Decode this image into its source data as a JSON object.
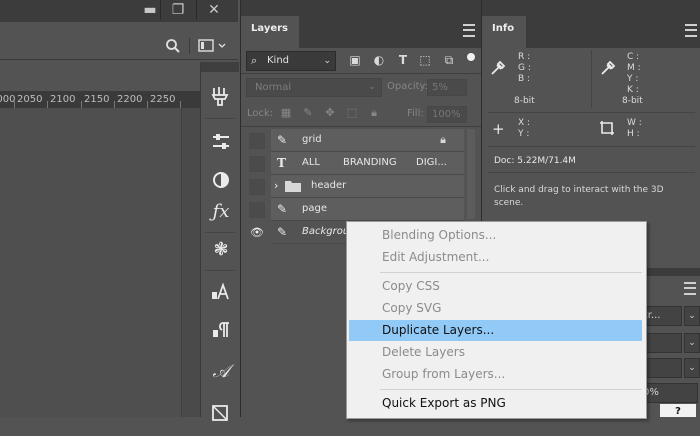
{
  "window": {
    "minimize_glyph": "▬",
    "restore_glyph": "❐",
    "close_glyph": "✕"
  },
  "options_bar": {
    "search_icon": "search-icon",
    "workspace_icon": "workspace-icon"
  },
  "ruler": {
    "ticks": [
      "2000",
      "2050",
      "2100",
      "2150",
      "2200",
      "2250"
    ]
  },
  "tools": [
    "brush-settings-icon",
    "adjust-icon",
    "color-icon",
    "styles-icon",
    "gear-wheel-icon",
    "character-icon",
    "paragraph-icon",
    "glyphs-icon",
    "swatch-icon"
  ],
  "layers_panel": {
    "tab_label": "Layers",
    "filter_kind": "Kind",
    "blend_mode": "Normal",
    "opacity_label": "Opacity:",
    "opacity_value": "5%",
    "lock_label": "Lock:",
    "fill_label": "Fill:",
    "fill_value": "100%",
    "layers": [
      {
        "name": "grid",
        "type": "brush",
        "visible": false,
        "locked": true
      },
      {
        "name": "ALL BRANDING DIGI...",
        "type": "text",
        "visible": false,
        "locked": false
      },
      {
        "name": "header",
        "type": "folder",
        "visible": false,
        "locked": false
      },
      {
        "name": "page",
        "type": "brush",
        "visible": false,
        "locked": false
      },
      {
        "name": "Backgroun",
        "type": "brush",
        "visible": true,
        "locked": false
      }
    ],
    "text_layer_words": [
      "ALL",
      "BRANDING",
      "DIGI..."
    ]
  },
  "info_panel": {
    "tab_label": "Info",
    "rgb_labels": [
      "R :",
      "G :",
      "B :"
    ],
    "cmyk_labels": [
      "C :",
      "M :",
      "Y :",
      "K :"
    ],
    "bit_depth_left": "8-bit",
    "bit_depth_right": "8-bit",
    "xy_labels": [
      "X :",
      "Y :"
    ],
    "wh_labels": [
      "W :",
      "H :"
    ],
    "doc_size": "Doc: 5.22M/71.4M",
    "hint": "Click and drag to interact with the 3D scene."
  },
  "props_panel": {
    "field1_text": "ltr...",
    "percent_value": "0%",
    "help_label": "?"
  },
  "context_menu": {
    "items": [
      {
        "label": "Blending Options...",
        "enabled": false,
        "highlighted": false
      },
      {
        "label": "Edit Adjustment...",
        "enabled": false,
        "highlighted": false
      },
      {
        "label": "Copy CSS",
        "enabled": false,
        "highlighted": false
      },
      {
        "label": "Copy SVG",
        "enabled": false,
        "highlighted": false
      },
      {
        "label": "Duplicate Layers...",
        "enabled": true,
        "highlighted": true
      },
      {
        "label": "Delete Layers",
        "enabled": false,
        "highlighted": false
      },
      {
        "label": "Group from Layers...",
        "enabled": false,
        "highlighted": false
      },
      {
        "label": "Quick Export as PNG",
        "enabled": true,
        "highlighted": false
      }
    ]
  },
  "colors": {
    "panel_bg": "#535353",
    "panel_dark": "#3c3c3c",
    "menu_bg": "#f0f0f0",
    "menu_highlight": "#91c9f7"
  }
}
